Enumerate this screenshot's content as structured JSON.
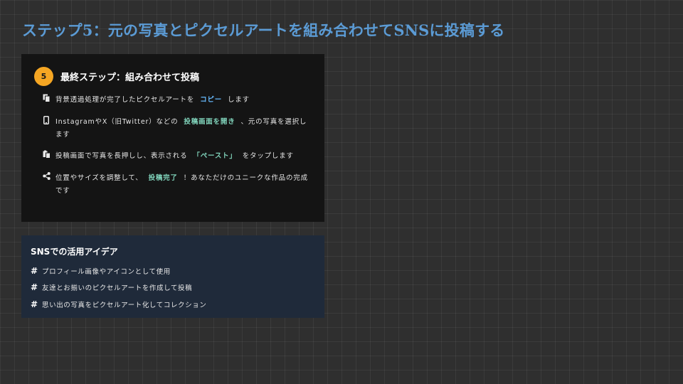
{
  "slide": {
    "title": "ステップ5：元の写真とピクセルアートを組み合わせてSNSに投稿する"
  },
  "steps_card": {
    "badge": "5",
    "title": "最終ステップ：組み合わせて投稿",
    "items": [
      {
        "icon": "copy-icon",
        "before": "背景透過処理が完了したピクセルアートを",
        "highlight": "コピー",
        "after": "します"
      },
      {
        "icon": "mobile-icon",
        "before": "InstagramやX（旧Twitter）などの",
        "highlight": "投稿画面を開き",
        "after": "、元の写真を選択します"
      },
      {
        "icon": "paste-icon",
        "before": "投稿画面で写真を長押しし、表示される",
        "highlight": "「ペースト」",
        "after": "をタップします"
      },
      {
        "icon": "share-icon",
        "before": "位置やサイズを調整して、",
        "highlight": "投稿完了",
        "after": "！あなただけのユニークな作品の完成です"
      }
    ]
  },
  "ideas_card": {
    "title": "SNSでの活用アイデア",
    "items": [
      "プロフィール画像やアイコンとして使用",
      "友達とお揃いのピクセルアートを作成して投稿",
      "思い出の写真をピクセルアート化してコレクション"
    ]
  },
  "colors": {
    "title": "#5b9bd5",
    "badge": "#f5a623",
    "highlight_green": "#7fd1b9",
    "highlight_blue": "#64b5f6",
    "steps_card_bg": "#141414",
    "ideas_card_bg": "#1f2a3a"
  }
}
